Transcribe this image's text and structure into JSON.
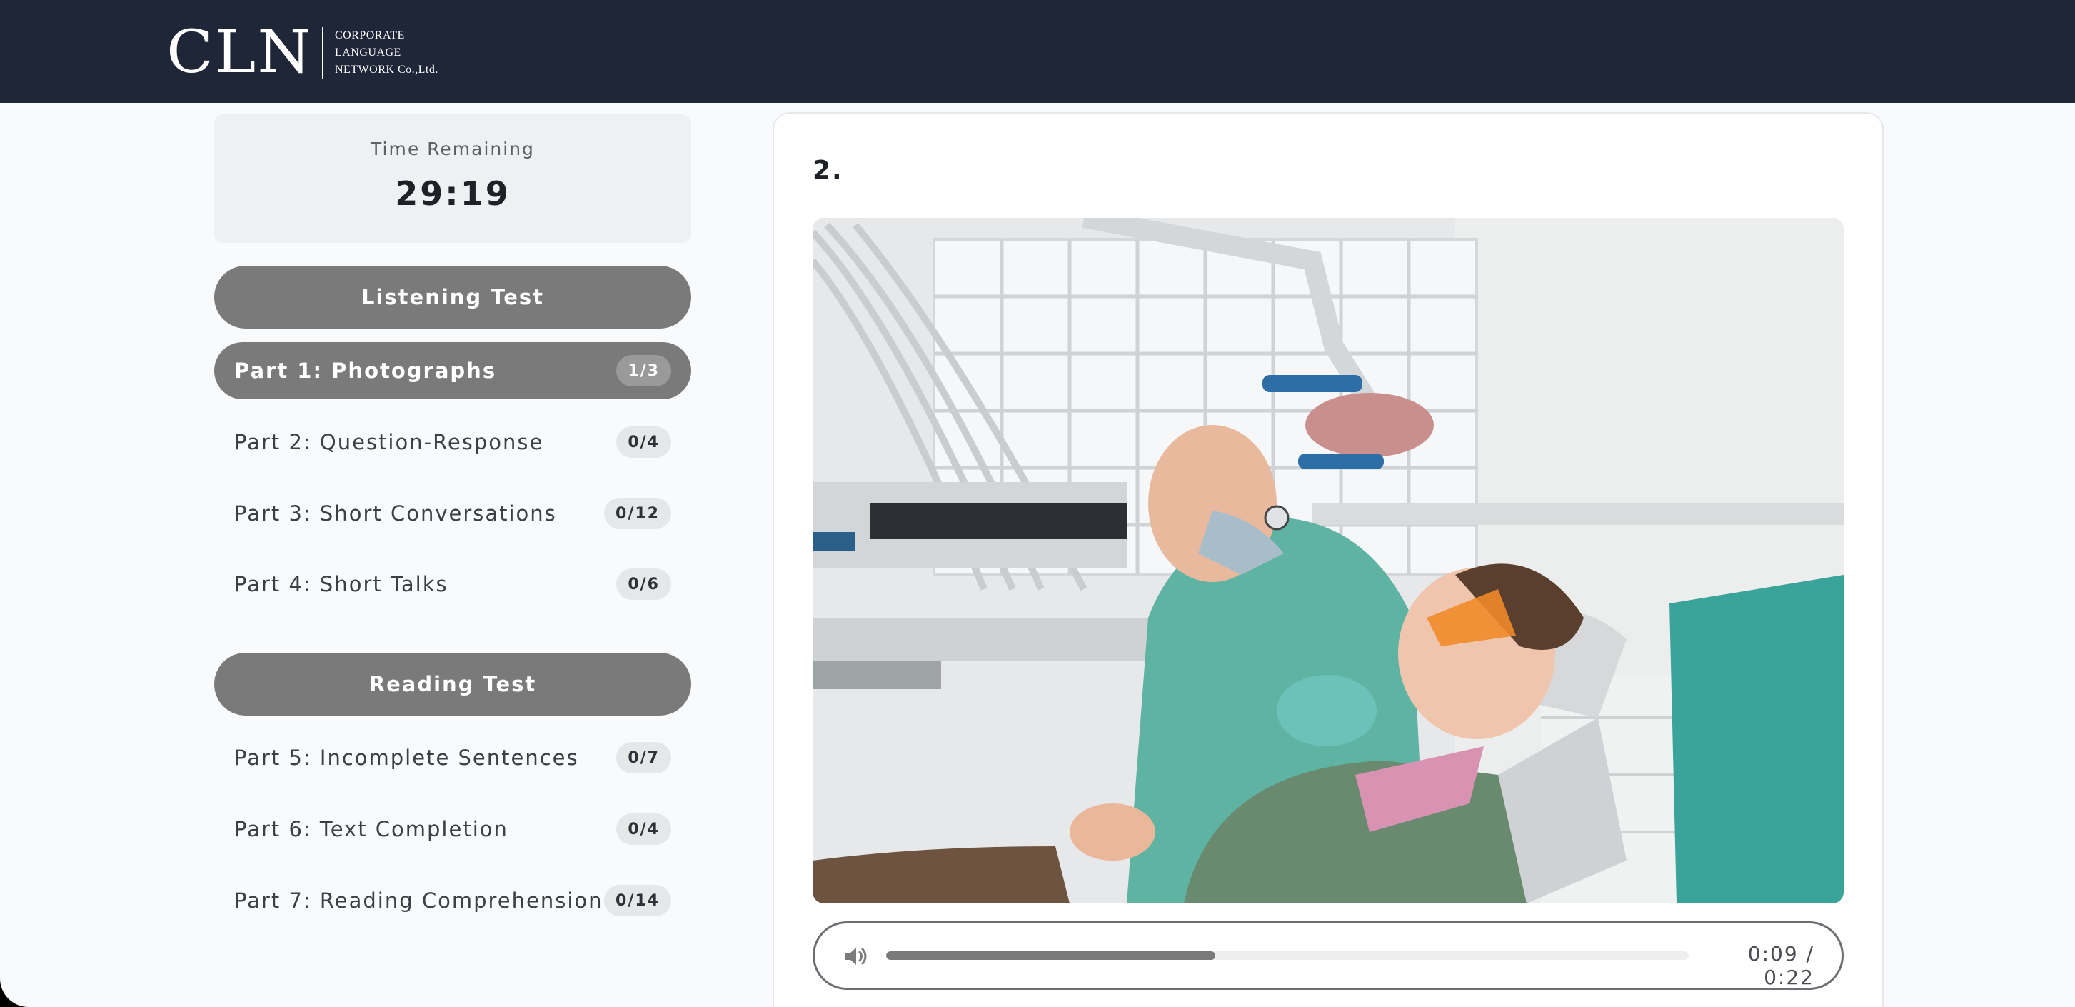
{
  "brand": {
    "mark": "CLN",
    "lines": [
      "CORPORATE",
      "LANGUAGE",
      "NETWORK Co.,Ltd."
    ]
  },
  "timer": {
    "label": "Time Remaining",
    "value": "29:19"
  },
  "listening": {
    "title": "Listening Test",
    "parts": [
      {
        "label": "Part 1: Photographs",
        "progress": "1/3",
        "active": true
      },
      {
        "label": "Part 2: Question-Response",
        "progress": "0/4"
      },
      {
        "label": "Part 3: Short Conversations",
        "progress": "0/12"
      },
      {
        "label": "Part 4: Short Talks",
        "progress": "0/6"
      }
    ]
  },
  "reading": {
    "title": "Reading Test",
    "parts": [
      {
        "label": "Part 5: Incomplete Sentences",
        "progress": "0/7"
      },
      {
        "label": "Part 6: Text Completion",
        "progress": "0/4"
      },
      {
        "label": "Part 7: Reading Comprehension",
        "progress": "0/14"
      }
    ]
  },
  "question": {
    "number": "2."
  },
  "audio": {
    "time": "0:09 / 0:22",
    "played_fraction": 0.41,
    "icon": "volume-icon"
  },
  "colors": {
    "header": "#1f2638",
    "active": "#7a7a7a",
    "accent_green": "#3aa39a"
  }
}
